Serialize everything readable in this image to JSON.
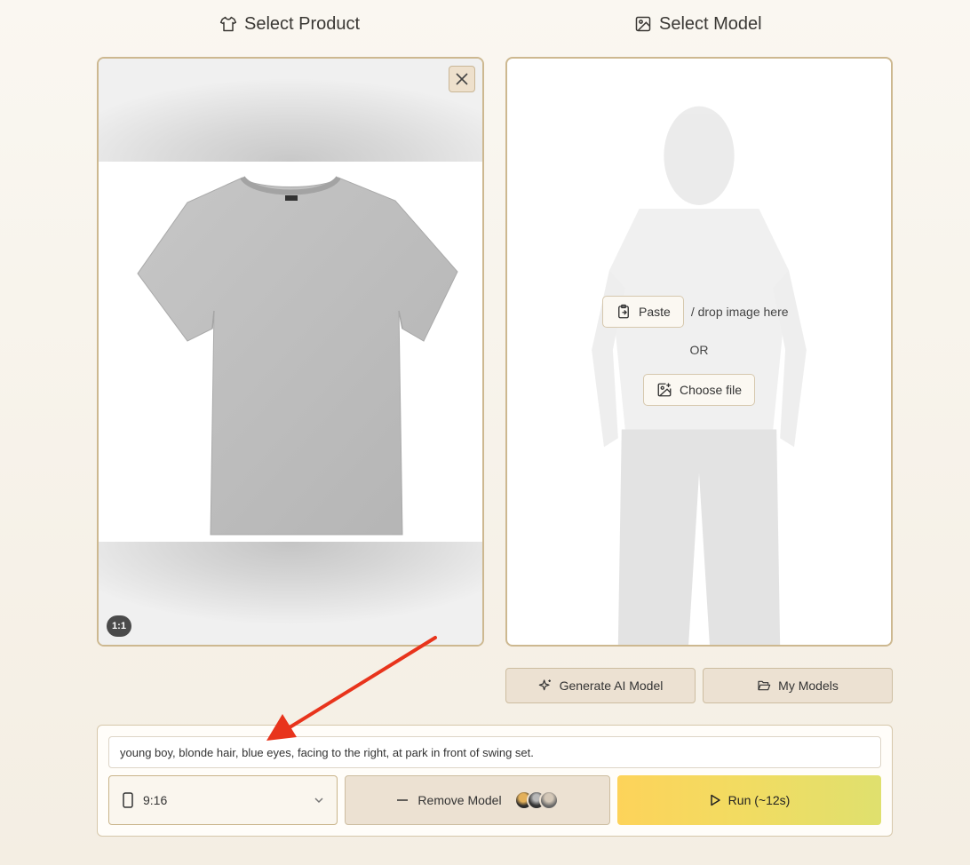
{
  "product_section": {
    "title": "Select Product",
    "icon": "tshirt-icon",
    "aspect_badge": "1:1"
  },
  "model_section": {
    "title": "Select Model",
    "icon": "image-icon",
    "paste_label": "Paste",
    "drop_text": "/ drop image here",
    "or_text": "OR",
    "choose_file_label": "Choose file"
  },
  "model_actions": {
    "generate_label": "Generate AI Model",
    "my_models_label": "My Models"
  },
  "bottom": {
    "prompt_value": "young boy, blonde hair, blue eyes, facing to the right, at park in front of swing set.",
    "aspect_value": "9:16",
    "remove_model_label": "Remove Model",
    "run_label": "Run (~12s)"
  },
  "colors": {
    "border_accent": "#cdb890",
    "run_gradient_start": "#fdd35a",
    "run_gradient_end": "#dfe06e",
    "annotation_arrow": "#e8341c"
  }
}
